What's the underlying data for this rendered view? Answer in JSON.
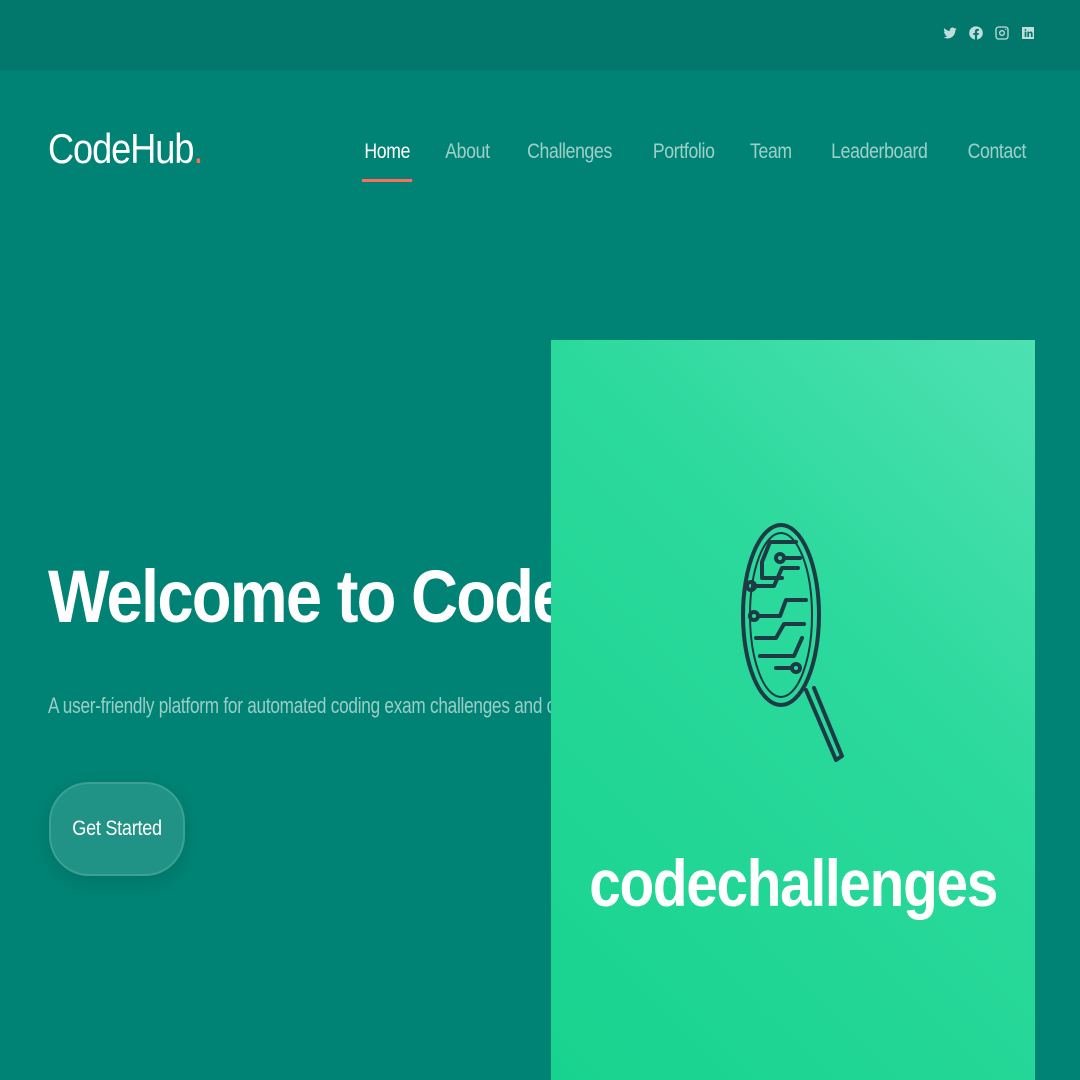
{
  "social": {
    "items": [
      {
        "name": "twitter",
        "icon": "twitter-icon"
      },
      {
        "name": "facebook",
        "icon": "facebook-icon"
      },
      {
        "name": "instagram",
        "icon": "instagram-icon"
      },
      {
        "name": "linkedin",
        "icon": "linkedin-icon"
      }
    ]
  },
  "logo": {
    "text": "CodeHub",
    "dot": "."
  },
  "nav": {
    "items": [
      {
        "label": "Home",
        "active": true
      },
      {
        "label": "About"
      },
      {
        "label": "Challenges"
      },
      {
        "label": "Portfolio"
      },
      {
        "label": "Team"
      },
      {
        "label": "Leaderboard"
      },
      {
        "label": "Contact"
      }
    ]
  },
  "hero": {
    "title": "Welcome to CodeHub",
    "subtitle": "A user-friendly platform for automated coding exam challenges and correcting",
    "cta_label": "Get Started",
    "image_brand": "codechallenges",
    "image_icon": "magnifier-circuit-icon"
  },
  "colors": {
    "background": "#008374",
    "topbar": "#01786b",
    "accent": "#f96f59",
    "image_green": "#1fd593"
  }
}
